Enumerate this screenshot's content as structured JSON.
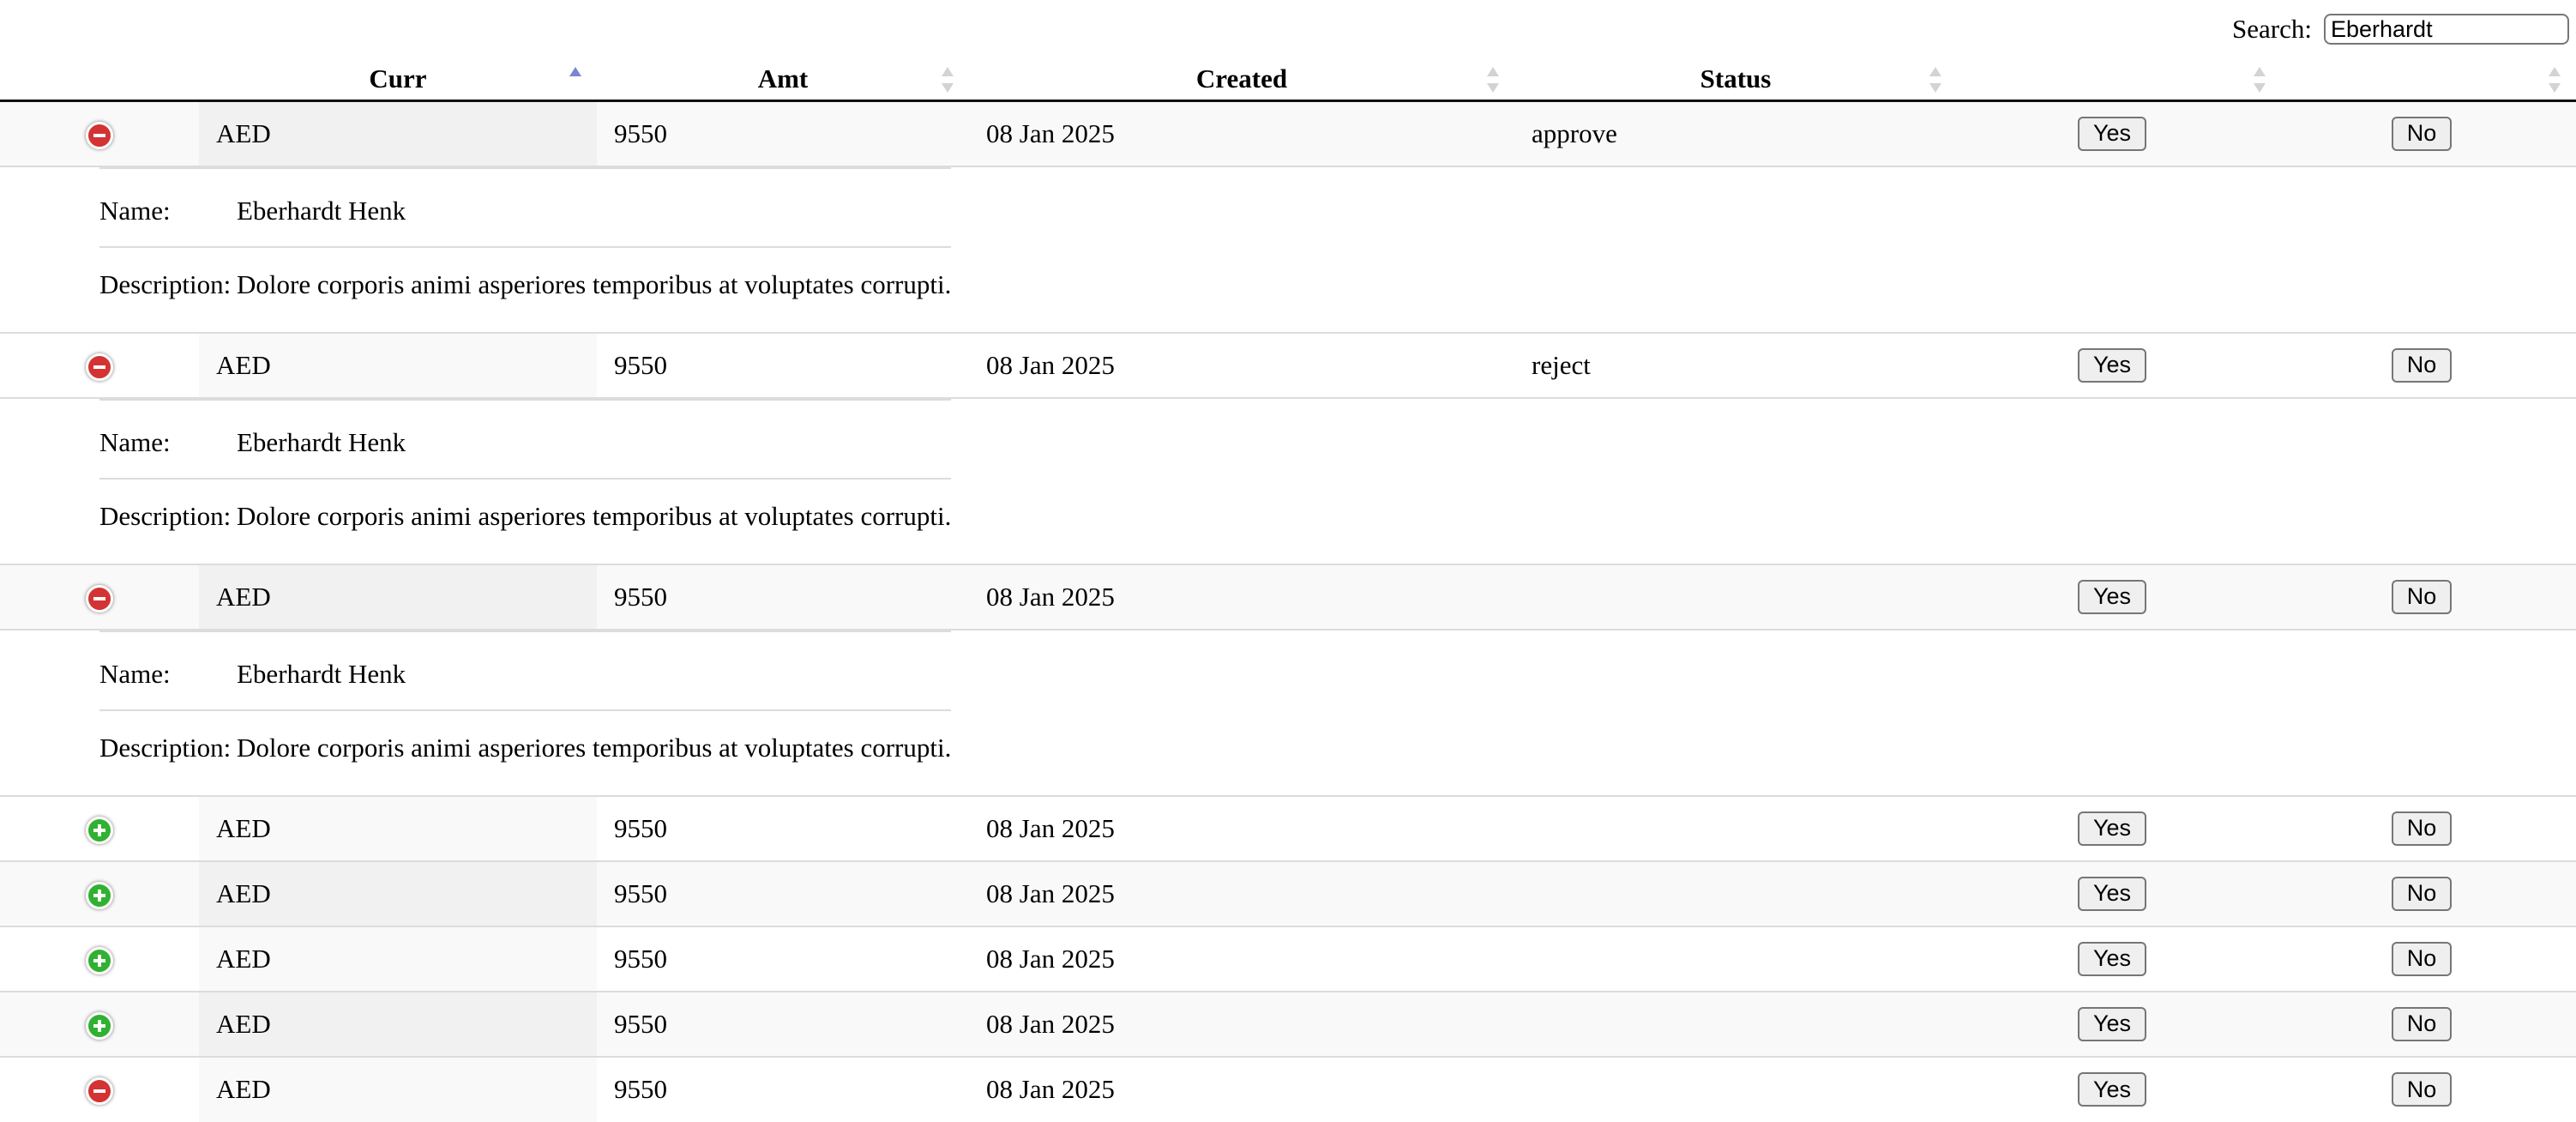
{
  "search": {
    "label": "Search:",
    "value": "Eberhardt"
  },
  "columns": [
    {
      "label": "Curr",
      "sort": "asc"
    },
    {
      "label": "Amt",
      "sort": "none"
    },
    {
      "label": "Created",
      "sort": "none"
    },
    {
      "label": "Status",
      "sort": "none"
    },
    {
      "label": "",
      "sort": "none"
    },
    {
      "label": "",
      "sort": "none"
    }
  ],
  "detail_labels": {
    "name": "Name:",
    "description": "Description:"
  },
  "rows": [
    {
      "expanded": true,
      "curr": "AED",
      "amt": "9550",
      "created": "08 Jan 2025",
      "status": "approve",
      "yes": "Yes",
      "no": "No",
      "details": {
        "name": "Eberhardt Henk",
        "description": "Dolore corporis animi asperiores temporibus at voluptates corrupti."
      }
    },
    {
      "expanded": true,
      "curr": "AED",
      "amt": "9550",
      "created": "08 Jan 2025",
      "status": "reject",
      "yes": "Yes",
      "no": "No",
      "details": {
        "name": "Eberhardt Henk",
        "description": "Dolore corporis animi asperiores temporibus at voluptates corrupti."
      }
    },
    {
      "expanded": true,
      "curr": "AED",
      "amt": "9550",
      "created": "08 Jan 2025",
      "status": "",
      "yes": "Yes",
      "no": "No",
      "details": {
        "name": "Eberhardt Henk",
        "description": "Dolore corporis animi asperiores temporibus at voluptates corrupti."
      }
    },
    {
      "expanded": false,
      "curr": "AED",
      "amt": "9550",
      "created": "08 Jan 2025",
      "status": "",
      "yes": "Yes",
      "no": "No"
    },
    {
      "expanded": false,
      "curr": "AED",
      "amt": "9550",
      "created": "08 Jan 2025",
      "status": "",
      "yes": "Yes",
      "no": "No"
    },
    {
      "expanded": false,
      "curr": "AED",
      "amt": "9550",
      "created": "08 Jan 2025",
      "status": "",
      "yes": "Yes",
      "no": "No"
    },
    {
      "expanded": false,
      "curr": "AED",
      "amt": "9550",
      "created": "08 Jan 2025",
      "status": "",
      "yes": "Yes",
      "no": "No"
    },
    {
      "expanded": true,
      "curr": "AED",
      "amt": "9550",
      "created": "08 Jan 2025",
      "status": "",
      "yes": "Yes",
      "no": "No"
    }
  ]
}
